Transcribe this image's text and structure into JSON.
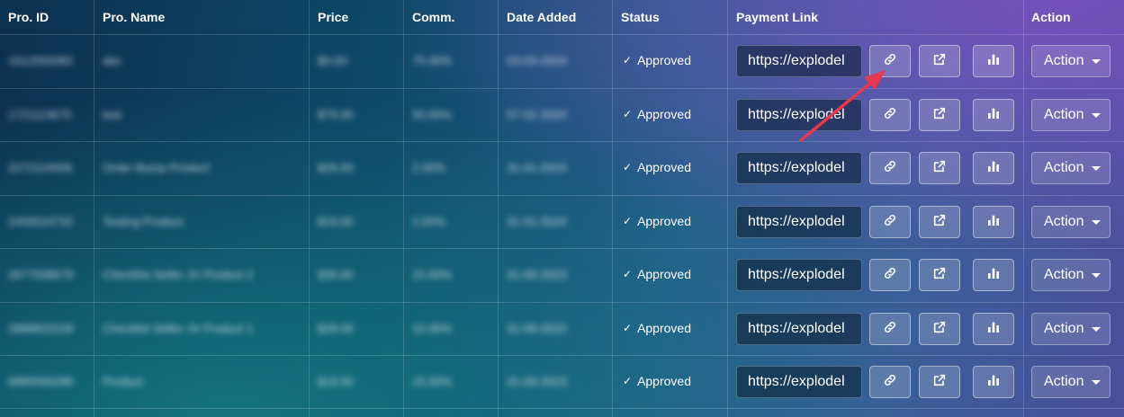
{
  "table": {
    "headers": {
      "pro_id": "Pro. ID",
      "pro_name": "Pro. Name",
      "price": "Price",
      "comm": "Comm.",
      "date_added": "Date Added",
      "status": "Status",
      "payment_link": "Payment Link",
      "action": "Action"
    },
    "rows": [
      {
        "id": "1612050082",
        "name": "abc",
        "price": "$0.00",
        "comm": "75.00%",
        "date": "03-03-2024",
        "status": "Approved",
        "link": "https://explodel",
        "action": "Action"
      },
      {
        "id": "1721113675",
        "name": "test",
        "price": "$79.00",
        "comm": "50.00%",
        "date": "07-02-2024",
        "status": "Approved",
        "link": "https://explodel",
        "action": "Action"
      },
      {
        "id": "2272115006",
        "name": "Order Bump Product",
        "price": "$29.00",
        "comm": "2.00%",
        "date": "31-01-2024",
        "status": "Approved",
        "link": "https://explodel",
        "action": "Action"
      },
      {
        "id": "2456524752",
        "name": "Testing Product",
        "price": "$19.00",
        "comm": "2.00%",
        "date": "31-01-2024",
        "status": "Approved",
        "link": "https://explodel",
        "action": "Action"
      },
      {
        "id": "2677508679",
        "name": "Checklist Seller JV Product 2",
        "price": "$39.00",
        "comm": "15.00%",
        "date": "31-09-2023",
        "status": "Approved",
        "link": "https://explodel",
        "action": "Action"
      },
      {
        "id": "2888822228",
        "name": "Checklist Seller JV Product 1",
        "price": "$29.00",
        "comm": "15.00%",
        "date": "31-09-2023",
        "status": "Approved",
        "link": "https://explodel",
        "action": "Action"
      },
      {
        "id": "6885566286",
        "name": "Product",
        "price": "$19.00",
        "comm": "15.00%",
        "date": "31-09-2023",
        "status": "Approved",
        "link": "https://explodel",
        "action": "Action"
      }
    ]
  },
  "icons": {
    "copy": "link-icon",
    "open": "external-link-icon",
    "stats": "bar-chart-icon",
    "status": "check-icon",
    "annotation": "red-arrow"
  },
  "colors": {
    "annotation_arrow": "#e8384f"
  }
}
